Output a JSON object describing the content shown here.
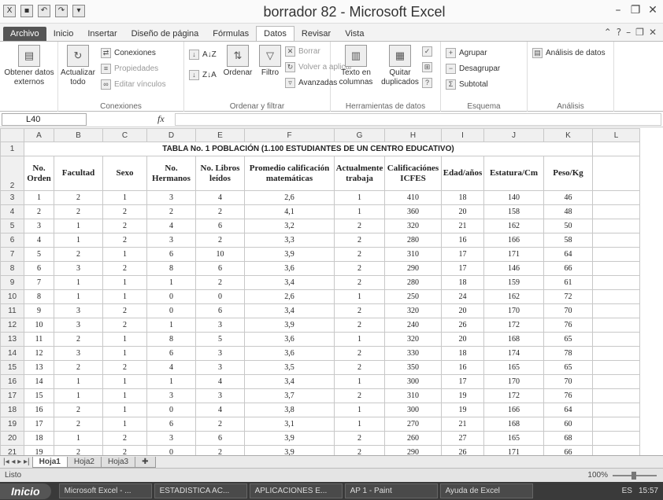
{
  "window": {
    "title": "borrador 82  -  Microsoft Excel"
  },
  "tabs": [
    "Archivo",
    "Inicio",
    "Insertar",
    "Diseño de página",
    "Fórmulas",
    "Datos",
    "Revisar",
    "Vista"
  ],
  "active_tab": "Datos",
  "ribbon": {
    "get_external": "Obtener datos externos",
    "refresh_all": "Actualizar todo",
    "connections": "Conexiones",
    "properties": "Propiedades",
    "edit_links": "Editar vínculos",
    "group_connections": "Conexiones",
    "sort_asc": "A↓Z",
    "sort_desc": "Z↓A",
    "sort": "Ordenar",
    "filter": "Filtro",
    "clear": "Borrar",
    "reapply": "Volver a aplicar",
    "advanced": "Avanzadas",
    "group_sort_filter": "Ordenar y filtrar",
    "text_to_columns": "Texto en columnas",
    "remove_duplicates": "Quitar duplicados",
    "group_data_tools": "Herramientas de datos",
    "group": "Agrupar",
    "ungroup": "Desagrupar",
    "subtotal": "Subtotal",
    "group_outline": "Esquema",
    "data_analysis": "Análisis de datos",
    "group_analysis": "Análisis"
  },
  "formula_bar": {
    "name_box": "L40",
    "fx": "fx",
    "content": ""
  },
  "sheet": {
    "columns": [
      "A",
      "B",
      "C",
      "D",
      "E",
      "F",
      "G",
      "H",
      "I",
      "J",
      "K",
      "L"
    ],
    "title": "TABLA No. 1 POBLACIÓN (1.100 ESTUDIANTES DE UN CENTRO EDUCATIVO)",
    "headers": [
      "No. Orden",
      "Facultad",
      "Sexo",
      "No. Hermanos",
      "No. Libros leídos",
      "Promedio calificación matemáticas",
      "Actualmente trabaja",
      "Calificaciónes ICFES",
      "Edad/años",
      "Estatura/Cm",
      "Peso/Kg"
    ],
    "rows": [
      [
        "1",
        "2",
        "1",
        "3",
        "4",
        "2,6",
        "1",
        "410",
        "18",
        "140",
        "46"
      ],
      [
        "2",
        "2",
        "2",
        "2",
        "2",
        "4,1",
        "1",
        "360",
        "20",
        "158",
        "48"
      ],
      [
        "3",
        "1",
        "2",
        "4",
        "6",
        "3,2",
        "2",
        "320",
        "21",
        "162",
        "50"
      ],
      [
        "4",
        "1",
        "2",
        "3",
        "2",
        "3,3",
        "2",
        "280",
        "16",
        "166",
        "58"
      ],
      [
        "5",
        "2",
        "1",
        "6",
        "10",
        "3,9",
        "2",
        "310",
        "17",
        "171",
        "64"
      ],
      [
        "6",
        "3",
        "2",
        "8",
        "6",
        "3,6",
        "2",
        "290",
        "17",
        "146",
        "66"
      ],
      [
        "7",
        "1",
        "1",
        "1",
        "2",
        "3,4",
        "2",
        "280",
        "18",
        "159",
        "61"
      ],
      [
        "8",
        "1",
        "1",
        "0",
        "0",
        "2,6",
        "1",
        "250",
        "24",
        "162",
        "72"
      ],
      [
        "9",
        "3",
        "2",
        "0",
        "6",
        "3,4",
        "2",
        "320",
        "20",
        "170",
        "70"
      ],
      [
        "10",
        "3",
        "2",
        "1",
        "3",
        "3,9",
        "2",
        "240",
        "26",
        "172",
        "76"
      ],
      [
        "11",
        "2",
        "1",
        "8",
        "5",
        "3,6",
        "1",
        "320",
        "20",
        "168",
        "65"
      ],
      [
        "12",
        "3",
        "1",
        "6",
        "3",
        "3,6",
        "2",
        "330",
        "18",
        "174",
        "78"
      ],
      [
        "13",
        "2",
        "2",
        "4",
        "3",
        "3,5",
        "2",
        "350",
        "16",
        "165",
        "65"
      ],
      [
        "14",
        "1",
        "1",
        "1",
        "4",
        "3,4",
        "1",
        "300",
        "17",
        "170",
        "70"
      ],
      [
        "15",
        "1",
        "1",
        "3",
        "3",
        "3,7",
        "2",
        "310",
        "19",
        "172",
        "76"
      ],
      [
        "16",
        "2",
        "1",
        "0",
        "4",
        "3,8",
        "1",
        "300",
        "19",
        "166",
        "64"
      ],
      [
        "17",
        "2",
        "1",
        "6",
        "2",
        "3,1",
        "1",
        "270",
        "21",
        "168",
        "60"
      ],
      [
        "18",
        "1",
        "2",
        "3",
        "6",
        "3,9",
        "2",
        "260",
        "27",
        "165",
        "68"
      ],
      [
        "19",
        "2",
        "2",
        "0",
        "2",
        "3,9",
        "2",
        "290",
        "26",
        "171",
        "66"
      ]
    ]
  },
  "sheet_tabs": [
    "Hoja1",
    "Hoja2",
    "Hoja3"
  ],
  "active_sheet": "Hoja1",
  "status": {
    "ready": "Listo",
    "zoom": "100%"
  },
  "taskbar": {
    "start": "Inicio",
    "tasks": [
      "Microsoft Excel - ...",
      "ESTADISTICA AC...",
      "APLICACIONES E...",
      "AP 1 - Paint",
      "Ayuda de Excel"
    ],
    "lang": "ES",
    "clock": "15:57"
  }
}
